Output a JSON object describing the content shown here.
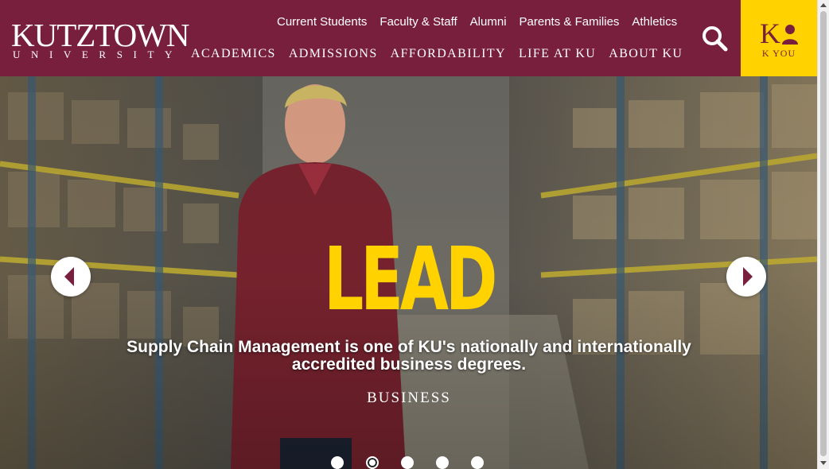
{
  "brand": {
    "name": "KUTZTOWN",
    "sub": "UNIVERSITY",
    "maroon": "#781f3d",
    "gold": "#ffd200"
  },
  "utility_nav": [
    "Current Students",
    "Faculty & Staff",
    "Alumni",
    "Parents & Families",
    "Athletics"
  ],
  "main_nav": [
    "ACADEMICS",
    "ADMISSIONS",
    "AFFORDABILITY",
    "LIFE AT KU",
    "ABOUT KU"
  ],
  "search": {
    "icon": "search-icon"
  },
  "k_you": {
    "label": "K YOU",
    "icon": "k-you-logo"
  },
  "hero": {
    "headline": "LEAD",
    "caption": "Supply Chain Management is one of KU's nationally and internationally accredited business degrees.",
    "category": "BUSINESS",
    "prev_icon": "chevron-left-icon",
    "next_icon": "chevron-right-icon",
    "slides_total": 5,
    "active_slide": 2
  }
}
